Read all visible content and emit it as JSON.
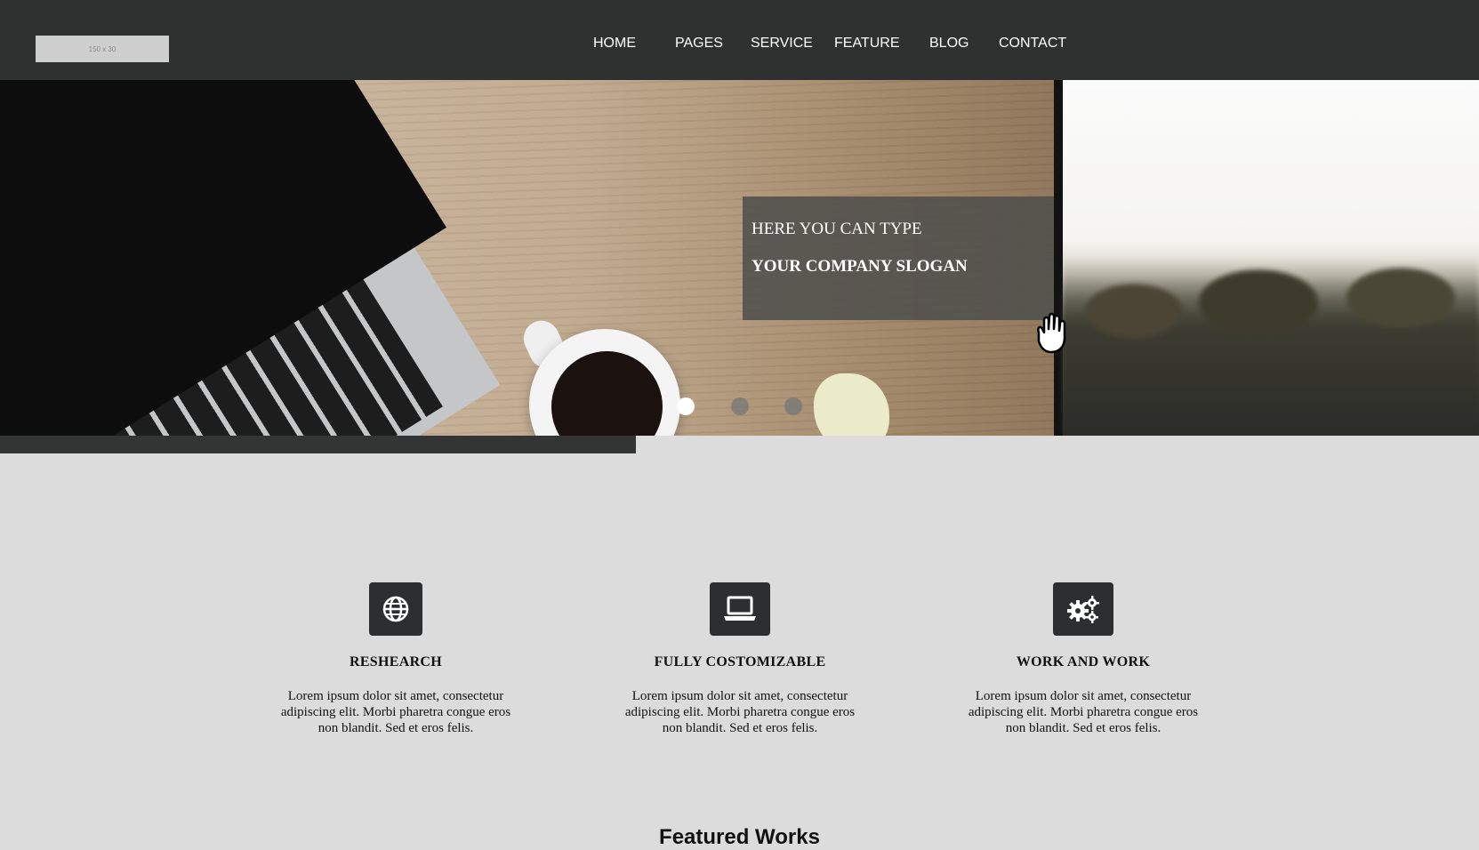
{
  "header": {
    "logo_text": "150 x 30",
    "nav": [
      {
        "label": "HOME"
      },
      {
        "label": "PAGES"
      },
      {
        "label": "SERVICE"
      },
      {
        "label": "FEATURE"
      },
      {
        "label": "BLOG"
      },
      {
        "label": "CONTACT"
      }
    ]
  },
  "hero": {
    "slogan_line1": "HERE YOU CAN TYPE",
    "slogan_line2": "YOUR COMPANY SLOGAN",
    "slides_total": 3,
    "active_slide": 1
  },
  "features": [
    {
      "icon": "globe-icon",
      "title": "RESHEARCH",
      "text": "Lorem ipsum dolor sit amet, consectetur adipiscing elit. Morbi pharetra congue eros non blandit. Sed et eros felis."
    },
    {
      "icon": "laptop-icon",
      "title": "FULLY COSTOMIZABLE",
      "text": "Lorem ipsum dolor sit amet, consectetur adipiscing elit. Morbi pharetra congue eros non blandit. Sed et eros felis."
    },
    {
      "icon": "gears-icon",
      "title": "WORK AND WORK",
      "text": "Lorem ipsum dolor sit amet, consectetur adipiscing elit. Morbi pharetra congue eros non blandit. Sed et eros felis."
    }
  ],
  "featured_works_heading": "Featured Works",
  "colors": {
    "header_bg": "#2f3131",
    "page_bg": "#dcdcdc",
    "icon_tile": "#2c2e2f",
    "slogan_box": "#504e4c"
  }
}
